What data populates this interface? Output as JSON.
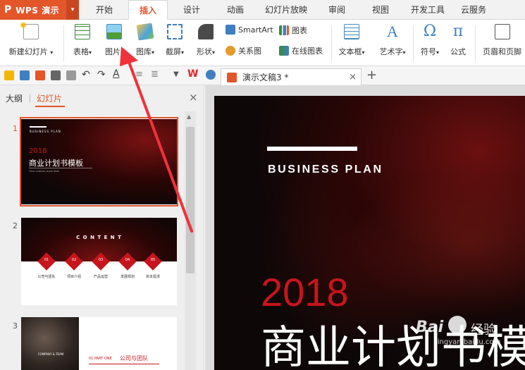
{
  "app": {
    "logo_letter": "P",
    "name": "WPS 演示",
    "logo_dropdown": "▾"
  },
  "tabs": [
    "开始",
    "插入",
    "设计",
    "动画",
    "幻灯片放映",
    "审阅",
    "视图",
    "开发工具",
    "云服务"
  ],
  "active_tab": "插入",
  "ribbon": {
    "new_slide": "新建幻灯片",
    "table": "表格",
    "picture": "图片",
    "gallery": "图库",
    "screenshot": "截屏",
    "shape": "形状",
    "smartart": "SmartArt",
    "chart": "图表",
    "relation": "关系图",
    "online_chart": "在线图表",
    "textbox": "文本框",
    "wordart": "艺术字",
    "symbol": "符号",
    "formula": "公式",
    "header_footer": "页眉和页脚",
    "dropdown_arrow": "▾"
  },
  "document_tab": {
    "title": "演示文稿3 *",
    "close": "×",
    "new": "+"
  },
  "panel": {
    "outline_tab": "大纲",
    "slides_tab": "幻灯片",
    "close": "×"
  },
  "thumbnails": [
    {
      "number": "1",
      "kicker": "BUSINESS PLAN",
      "year": "2018",
      "title": "商业计划书模板",
      "sub": "YOUR COMPANY NAME HERE"
    },
    {
      "number": "2",
      "heading": "C O N T E N T",
      "nums": [
        "01",
        "02",
        "03",
        "04",
        "05"
      ],
      "labels": [
        "公司与团队",
        "项目介绍",
        "产品运营",
        "发展规划",
        "资本需求"
      ]
    },
    {
      "number": "3",
      "badge": "COMPANY & TEAM",
      "part": "01 PART ONE",
      "title": "公司与团队"
    }
  ],
  "slide": {
    "kicker": "BUSINESS PLAN",
    "year": "2018",
    "title": "商业计划书模板"
  },
  "watermark": {
    "brand": "Bai",
    "brand2": "经验",
    "url": "jingyan.baidu.com"
  },
  "colors": {
    "accent": "#e2562a",
    "red": "#c8141c"
  }
}
